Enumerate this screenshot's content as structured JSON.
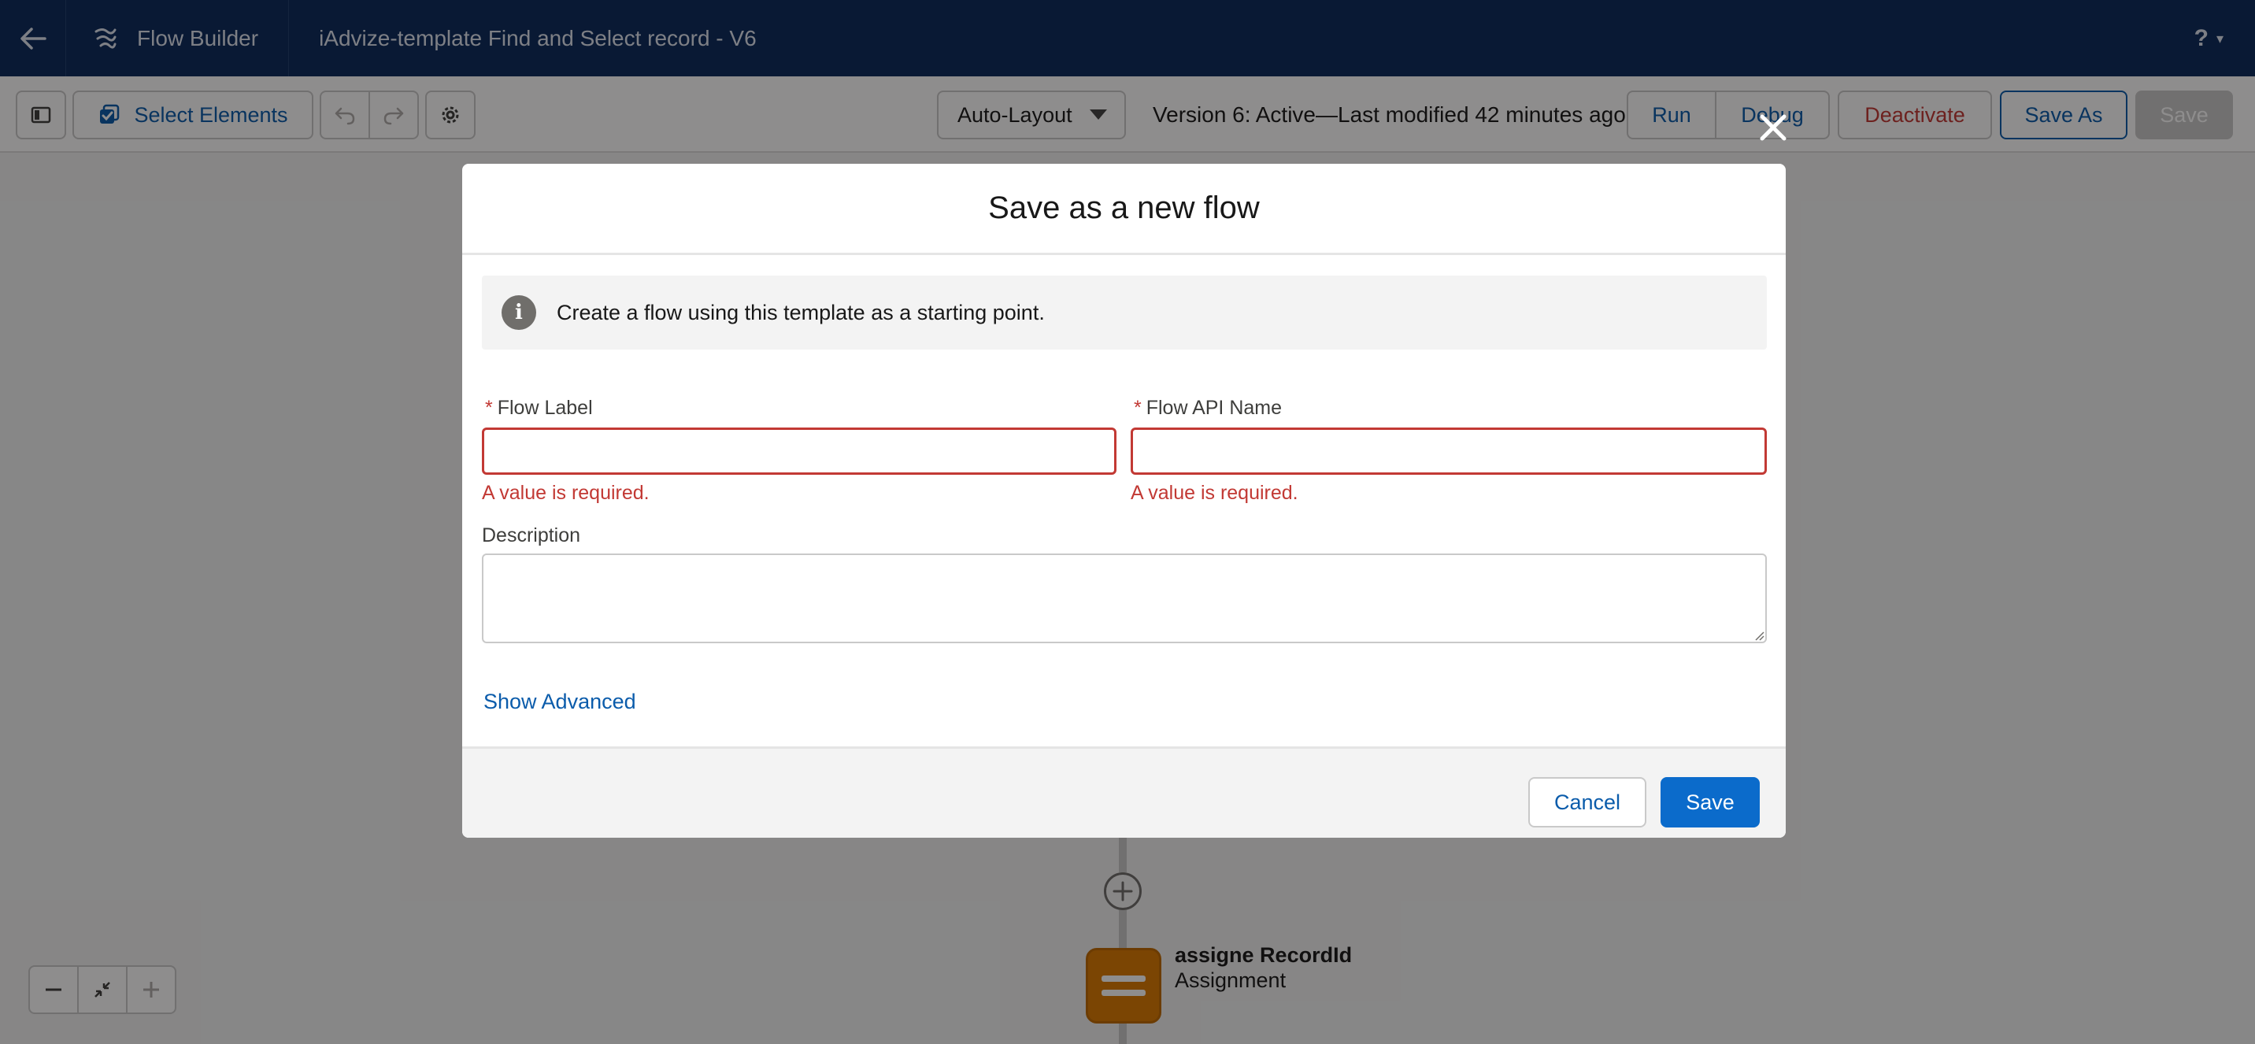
{
  "header": {
    "app_name": "Flow Builder",
    "flow_title": "iAdvize-template Find and Select record - V6",
    "help_label": "?"
  },
  "toolbar": {
    "select_elements_label": "Select Elements",
    "layout_mode": "Auto-Layout",
    "version_status": "Version 6: Active—Last modified 42 minutes ago",
    "run_label": "Run",
    "debug_label": "Debug",
    "deactivate_label": "Deactivate",
    "save_as_label": "Save As",
    "save_label": "Save"
  },
  "canvas": {
    "node_title": "assigne RecordId",
    "node_type": "Assignment"
  },
  "modal": {
    "title": "Save as a new flow",
    "info_text": "Create a flow using this template as a starting point.",
    "flow_label": {
      "label": "Flow Label",
      "required_marker": "*",
      "value": "",
      "error": "A value is required."
    },
    "flow_api_name": {
      "label": "Flow API Name",
      "required_marker": "*",
      "value": "",
      "error": "A value is required."
    },
    "description": {
      "label": "Description",
      "value": ""
    },
    "show_advanced_label": "Show Advanced",
    "cancel_label": "Cancel",
    "save_label": "Save"
  },
  "colors": {
    "header_bg": "#0b2a5c",
    "brand_blue": "#0b5cab",
    "error_red": "#c23934",
    "assignment_orange": "#dd7a01"
  },
  "icons": [
    "back-arrow-icon",
    "flow-builder-icon",
    "help-icon",
    "panel-toggle-icon",
    "select-elements-icon",
    "undo-icon",
    "redo-icon",
    "gear-icon",
    "close-icon",
    "info-icon",
    "add-element-icon",
    "assignment-icon",
    "zoom-out-icon",
    "fit-view-icon",
    "zoom-in-icon"
  ]
}
